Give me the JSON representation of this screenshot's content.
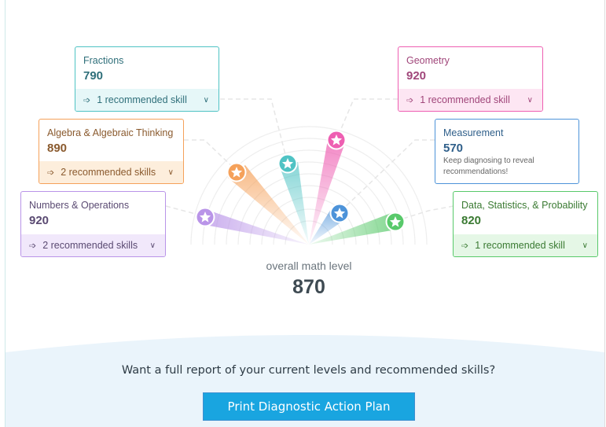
{
  "skills": [
    {
      "key": "fractions",
      "title": "Fractions",
      "score": "790",
      "recommendation": "1 recommended skill",
      "color": "#4fc3c4",
      "bg": "#e6f7f8",
      "score_color": "#2f6f7a"
    },
    {
      "key": "algebra",
      "title": "Algebra & Algebraic Thinking",
      "score": "890",
      "recommendation": "2 recommended skills",
      "color": "#f5a15a",
      "bg": "#fdeedc",
      "score_color": "#8a5a2e"
    },
    {
      "key": "numbers",
      "title": "Numbers & Operations",
      "score": "920",
      "recommendation": "2 recommended skills",
      "color": "#b994e8",
      "bg": "#f1e8fb",
      "score_color": "#5a4a72"
    },
    {
      "key": "geometry",
      "title": "Geometry",
      "score": "920",
      "recommendation": "1 recommended skill",
      "color": "#ee5fb2",
      "bg": "#fde6f3",
      "score_color": "#a0467a"
    },
    {
      "key": "measurement",
      "title": "Measurement",
      "score": "570",
      "note": "Keep diagnosing to reveal recommendations!",
      "color": "#4d93d9",
      "bg": "#ffffff",
      "score_color": "#2f5f8a"
    },
    {
      "key": "data",
      "title": "Data, Statistics, & Probability",
      "score": "820",
      "recommendation": "1 recommended skill",
      "color": "#58c96a",
      "bg": "#e5f7e6",
      "score_color": "#3a7a32"
    }
  ],
  "overall": {
    "label": "overall math level",
    "value": "870"
  },
  "footer": {
    "prompt": "Want a full report of your current levels and recommended skills?",
    "button_label": "Print Diagnostic Action Plan"
  },
  "icons": {
    "recommendation": "pointing-hand-icon",
    "expand": "chevron-down-icon",
    "marker": "star-icon"
  },
  "colors": {
    "accent": "#19a5e0",
    "footer_bg": "#eaf4fb"
  }
}
